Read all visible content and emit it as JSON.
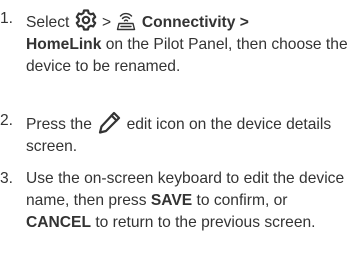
{
  "steps": [
    {
      "number": "1.",
      "pre": "Select",
      "icon1": "gear-settings-icon",
      "sep1": ">",
      "icon2": "connectivity-waves-icon",
      "path_label": "Connectivity >",
      "path_target": "HomeLink",
      "tail": "on the Pilot Panel, then choose the device to be renamed."
    },
    {
      "number": "2.",
      "pre": "Press the",
      "icon": "pencil-edit-icon",
      "tail": "edit icon on the device details screen."
    },
    {
      "number": "3.",
      "pre": "Use the on-screen keyboard to edit the device name, then press",
      "save_label": "SAVE",
      "mid": "to confirm, or",
      "cancel_label": "CANCEL",
      "tail": "to return to the previous screen."
    }
  ],
  "colors": {
    "text": "#333333",
    "icon": "#333333",
    "background": "#ffffff"
  }
}
